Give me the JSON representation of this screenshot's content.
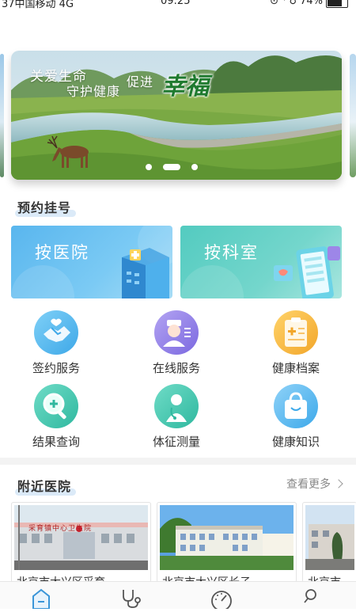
{
  "status_bar": {
    "carrier": "37中国移动 4G",
    "time": "09:25",
    "indicators": "⊙ ⁴ ♁ 74%",
    "battery_percent": 74
  },
  "banner": {
    "slogan_1": "关爱生命",
    "slogan_2": "守护健康",
    "slogan_3": "促进",
    "slogan_4": "幸福",
    "slide_count": 3,
    "active_slide": 2
  },
  "appointment": {
    "title": "预约挂号",
    "by_hospital": "按医院",
    "by_department": "按科室"
  },
  "services": [
    {
      "label": "签约服务",
      "icon": "handshake-icon",
      "color": "#52b7ec"
    },
    {
      "label": "在线服务",
      "icon": "doctor-chat-icon",
      "color": "#8e7de6"
    },
    {
      "label": "健康档案",
      "icon": "clipboard-icon",
      "color": "#f6b332"
    },
    {
      "label": "结果查询",
      "icon": "search-plus-icon",
      "color": "#37c4ad"
    },
    {
      "label": "体征测量",
      "icon": "stethoscope-doctor-icon",
      "color": "#37c4ad"
    },
    {
      "label": "健康知识",
      "icon": "shopping-bag-icon",
      "color": "#4cb2ef"
    }
  ],
  "nearby": {
    "title": "附近医院",
    "more_label": "查看更多",
    "hospitals": [
      {
        "name_partial": "北京市大兴区采育",
        "sign_text": "采育镇中心卫生院"
      },
      {
        "name_partial": "北京市大兴区长子",
        "sign_text": ""
      },
      {
        "name_partial": "北京市",
        "sign_text": ""
      }
    ]
  },
  "tabbar": {
    "items": [
      {
        "icon": "home-icon",
        "active": true
      },
      {
        "icon": "stethoscope-icon",
        "active": false
      },
      {
        "icon": "gauge-icon",
        "active": false
      },
      {
        "icon": "search-icon",
        "active": false
      }
    ],
    "accent": "#3a95d8"
  }
}
